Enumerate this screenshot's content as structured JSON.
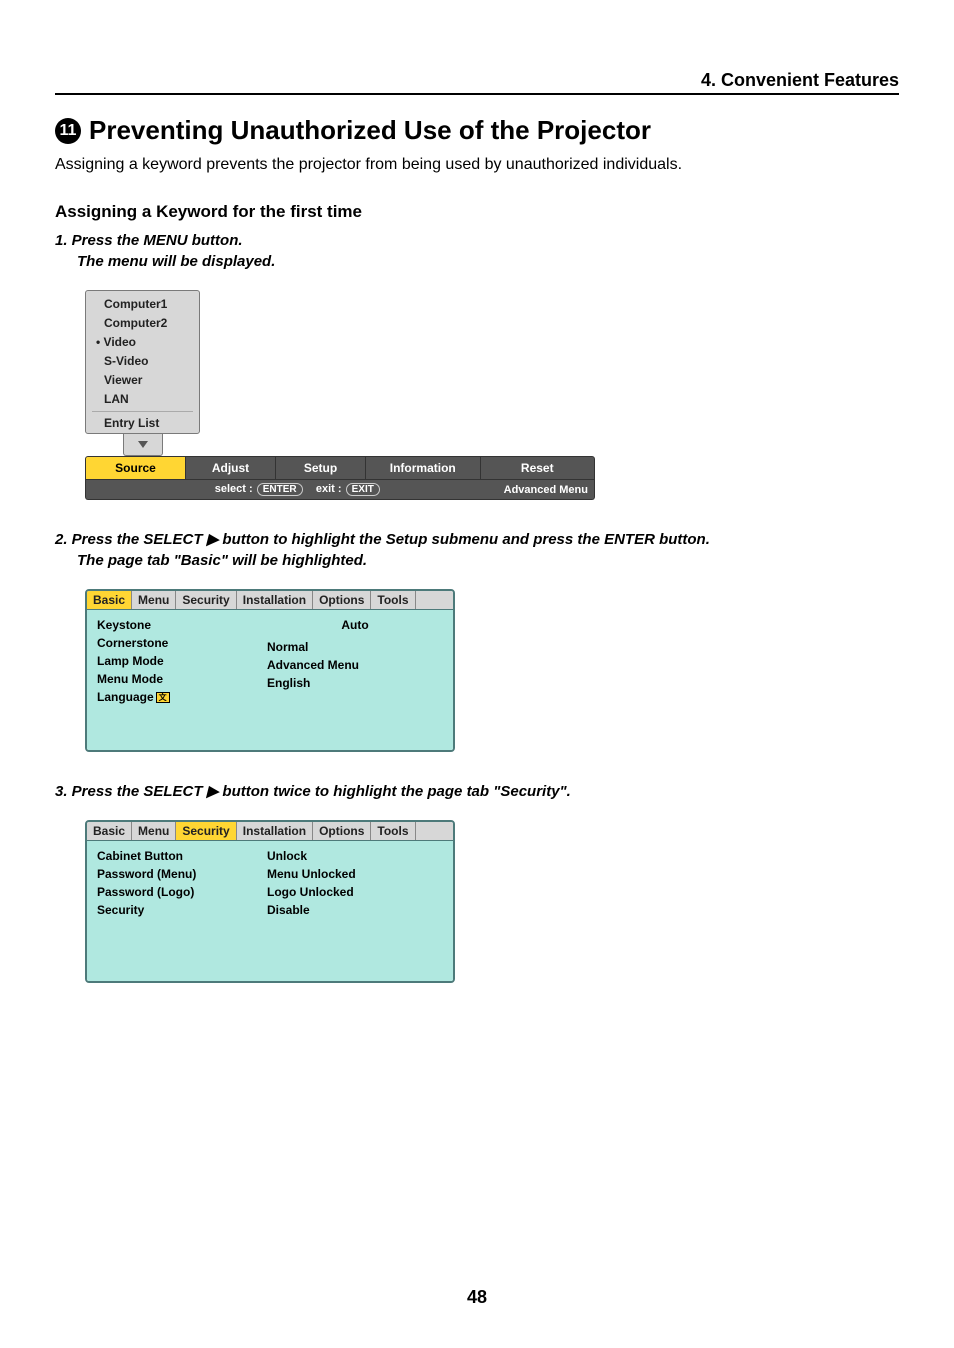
{
  "header": "4. Convenient Features",
  "section_number": "11",
  "section_title": "Preventing Unauthorized Use of the Projector",
  "intro": "Assigning a keyword prevents the projector from being used by unauthorized individuals.",
  "sub_heading": "Assigning a Keyword for the first time",
  "step1": "1. Press the MENU button.",
  "step1_sub": "The menu will be displayed.",
  "menu1": {
    "items": [
      "Computer1",
      "Computer2",
      "Video",
      "S-Video",
      "Viewer",
      "LAN"
    ],
    "entry_list": "Entry List",
    "bar": [
      "Source",
      "Adjust",
      "Setup",
      "Information",
      "Reset"
    ],
    "footer_select": "select :",
    "footer_enter": "ENTER",
    "footer_exit_lbl": "exit :",
    "footer_exit": "EXIT",
    "footer_right": "Advanced Menu"
  },
  "step2": "2. Press the SELECT ▶ button to highlight the Setup submenu and press the ENTER button.",
  "step2_sub": "The page tab \"Basic\" will be highlighted.",
  "submenu_tabs": [
    "Basic",
    "Menu",
    "Security",
    "Installation",
    "Options",
    "Tools"
  ],
  "submenu2": {
    "left": [
      "Keystone",
      "Cornerstone",
      "Lamp Mode",
      "Menu Mode",
      "Language"
    ],
    "right": [
      "Auto",
      "",
      "Normal",
      "Advanced Menu",
      "English"
    ]
  },
  "step3": "3. Press the SELECT ▶ button twice to highlight the page tab \"Security\".",
  "submenu3": {
    "left": [
      "Cabinet Button",
      "Password (Menu)",
      "Password (Logo)",
      "Security"
    ],
    "right": [
      "Unlock",
      "Menu Unlocked",
      "Logo Unlocked",
      "Disable"
    ]
  },
  "page_number": "48"
}
